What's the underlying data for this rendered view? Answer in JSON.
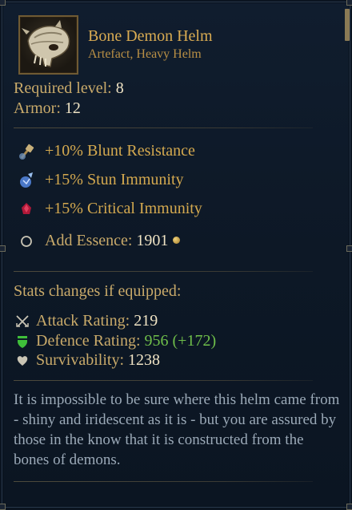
{
  "item": {
    "name": "Bone Demon Helm",
    "type": "Artefact, Heavy Helm",
    "icon": "bone-demon-skull-helm"
  },
  "requirements": {
    "level_label": "Required level:",
    "level_value": "8",
    "armor_label": "Armor:",
    "armor_value": "12"
  },
  "modifiers": [
    {
      "icon": "blunt-resistance-icon",
      "text": "+10% Blunt Resistance"
    },
    {
      "icon": "stun-immunity-icon",
      "text": "+15% Stun Immunity"
    },
    {
      "icon": "critical-immunity-icon",
      "text": "+15% Critical Immunity"
    }
  ],
  "essence": {
    "label": "Add Essence:",
    "value": "1901",
    "icon": "essence-coin"
  },
  "stats_changes": {
    "title": "Stats changes if equipped:",
    "attack": {
      "label": "Attack Rating:",
      "value": "219",
      "icon": "crossed-swords-icon"
    },
    "defence": {
      "label": "Defence Rating:",
      "value": "956 (+172)",
      "icon": "shield-icon"
    },
    "survivability": {
      "label": "Survivability:",
      "value": "1238",
      "icon": "heart-icon"
    }
  },
  "description": "It is impossible to be sure where this helm came from - shiny and iridescent as it is - but you are assured by those in the know that it is constructed from the bones of demons.",
  "colors": {
    "title": "#d9ab52",
    "label": "#c9aa6a",
    "value": "#efe3c4",
    "positive": "#6fbf4a",
    "lore": "#9ba9b7"
  }
}
